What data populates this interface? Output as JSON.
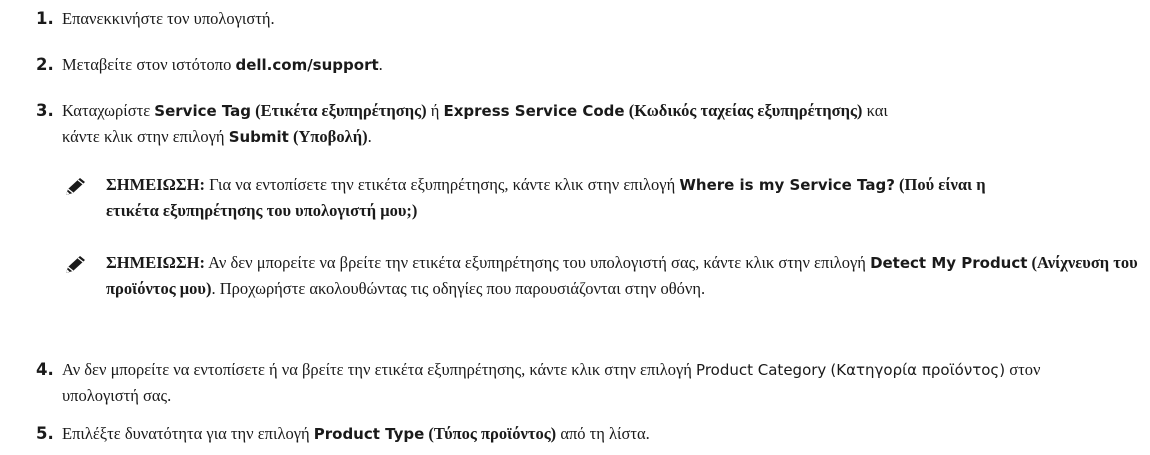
{
  "steps": [
    {
      "number": "1.",
      "text": "Επανεκκινήστε τον υπολογιστή."
    },
    {
      "number": "2.",
      "text_before": "Μεταβείτε στον ιστότοπο ",
      "link": "dell.com/support",
      "text_after": "."
    },
    {
      "number": "3.",
      "text_a": "Καταχωρίστε ",
      "ui_a": "Service Tag",
      "gr_a": " (Ετικέτα εξυπηρέτησης)",
      "text_b": " ή ",
      "ui_b": "Express Service Code",
      "gr_b": " (Κωδικός ταχείας εξυπηρέτησης)",
      "text_c": " και κάντε κλικ στην επιλογή ",
      "ui_c": "Submit",
      "gr_c": " (Υποβολή)",
      "text_d": "."
    },
    {
      "number": "4.",
      "text_a": "Αν δεν μπορείτε να εντοπίσετε ή να βρείτε την ετικέτα εξυπηρέτησης, κάντε κλικ στην επιλογή ",
      "ui_a": "Product Category",
      "text_b": " ",
      "ui_b": "(Κατηγορία προϊόντος)",
      "text_c": " στον υπολογιστή σας."
    },
    {
      "number": "5.",
      "text_a": "Επιλέξτε δυνατότητα για την επιλογή ",
      "ui_a": "Product Type",
      "gr_a": " (Τύπος προϊόντος)",
      "text_b": " από τη λίστα."
    }
  ],
  "notes": [
    {
      "icon": "pencil-note-icon",
      "label": "ΣΗΜΕΙΩΣΗ:",
      "text_a": " Για να εντοπίσετε την ετικέτα εξυπηρέτησης, κάντε κλικ στην επιλογή ",
      "ui_a": "Where is my Service Tag?",
      "gr_a": " (Πού είναι η ετικέτα εξυπηρέτησης του υπολογιστή μου;)"
    },
    {
      "icon": "pencil-note-icon",
      "label": "ΣΗΜΕΙΩΣΗ:",
      "text_a": " Αν δεν μπορείτε να βρείτε την ετικέτα εξυπηρέτησης του υπολογιστή σας, κάντε κλικ στην επιλογή ",
      "ui_a": "Detect My Product",
      "gr_a": " (Ανίχνευση του προϊόντος μου)",
      "text_b": ". Προχωρήστε ακολουθώντας τις οδηγίες που παρουσιάζονται στην οθόνη."
    }
  ]
}
